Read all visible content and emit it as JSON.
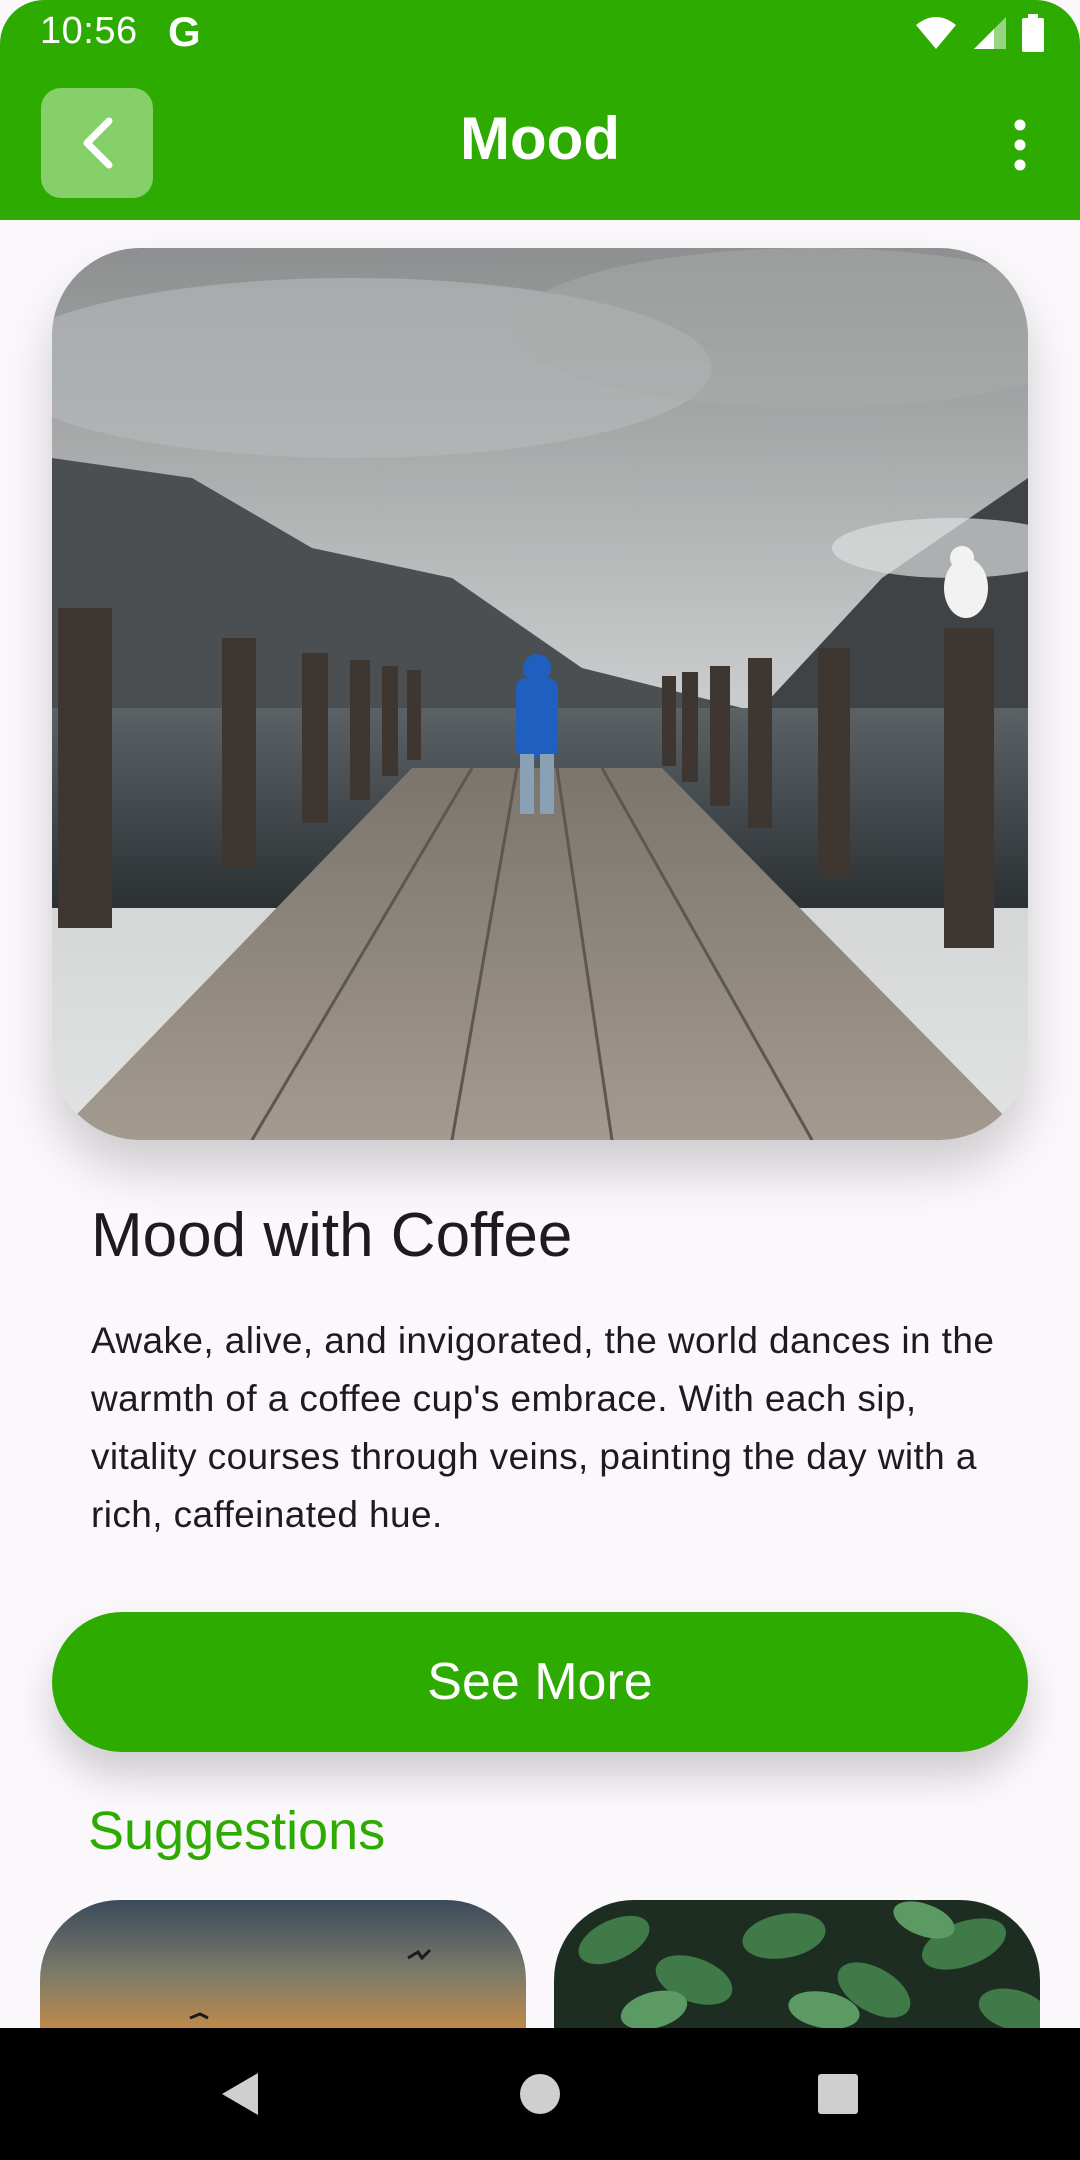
{
  "status_bar": {
    "time": "10:56",
    "carrier_logo": "G",
    "icons": [
      "wifi-icon",
      "signal-icon",
      "battery-icon"
    ]
  },
  "app_bar": {
    "title": "Mood",
    "back_icon": "chevron-left-icon",
    "menu_icon": "more-vert-icon"
  },
  "card": {
    "title": "Mood with Coffee",
    "description": "Awake, alive, and invigorated, the world dances in the warmth of a coffee cup's embrace. With each sip, vitality courses through veins, painting the day with a rich, caffeinated hue."
  },
  "actions": {
    "see_more_label": "See More"
  },
  "suggestions": {
    "title": "Suggestions"
  },
  "colors": {
    "primary": "#2eab00",
    "back_button_bg": "#86d06a",
    "background": "#fbf8fb"
  }
}
